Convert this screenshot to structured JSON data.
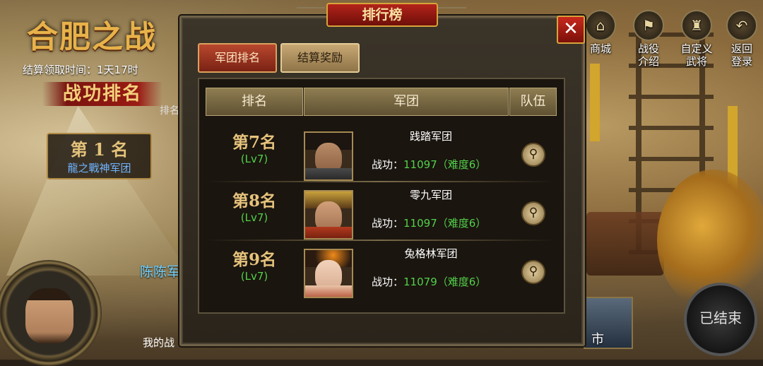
{
  "background": {
    "battle_title": "合肥之战",
    "claim_time": "结算领取时间：1天17时",
    "merit_rank": "战功排名",
    "rank_tab": "排名",
    "first_place": {
      "rank": "第 1 名",
      "name": "龍之戰神军团"
    },
    "player_name": "陈陈军",
    "my_label": "我的战",
    "top_buttons": [
      {
        "label": "商城",
        "icon": "shop-icon"
      },
      {
        "label": "战役\n介绍",
        "icon": "campaign-icon"
      },
      {
        "label": "自定义\n武将",
        "icon": "custom-general-icon"
      },
      {
        "label": "返回\n登录",
        "icon": "return-icon"
      }
    ],
    "ended_label": "已结束",
    "market_label": "市"
  },
  "dialog": {
    "title": "排行榜",
    "close_icon": "✕",
    "tabs": {
      "legion_rank": "军团排名",
      "settlement_reward": "结算奖励"
    },
    "headers": {
      "rank": "排名",
      "legion": "军团",
      "team": "队伍"
    },
    "rows": [
      {
        "rank": "第7名",
        "level": "(Lv7)",
        "name": "践踏军团",
        "merit_label": "战功：",
        "merit": "11097（难度6）",
        "portrait": "bearded-general"
      },
      {
        "rank": "第8名",
        "level": "(Lv7)",
        "name": "零九军团",
        "merit_label": "战功：",
        "merit": "11097（难度6）",
        "portrait": "crowned-general"
      },
      {
        "rank": "第9名",
        "level": "(Lv7)",
        "name": "兔格林军团",
        "merit_label": "战功：",
        "merit": "11079（难度6）",
        "portrait": "lady-general"
      }
    ],
    "search_icon": "⚲"
  },
  "colors": {
    "accent_gold": "#e6c37c",
    "level_green": "#53d04a",
    "active_tab": "#b9472e",
    "close_red": "#c8281c"
  }
}
